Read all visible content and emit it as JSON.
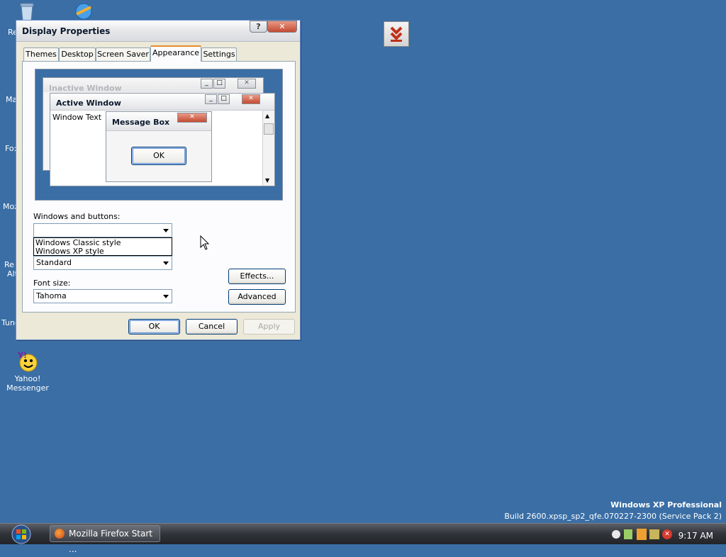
{
  "desktop": {
    "yahoo_label": "Yahoo!\nMessenger",
    "clipped_labels": [
      "Re",
      "Ma",
      "Fo:",
      "Moz",
      "Re",
      "Alt",
      "Tune"
    ]
  },
  "dialog": {
    "title": "Display Properties",
    "help_symbol": "?",
    "close_symbol": "✕",
    "tabs": [
      "Themes",
      "Desktop",
      "Screen Saver",
      "Appearance",
      "Settings"
    ],
    "active_tab": "Appearance",
    "preview": {
      "inactive_title": "Inactive Window",
      "active_title": "Active Window",
      "window_text": "Window Text",
      "msgbox_title": "Message Box",
      "msgbox_ok": "OK"
    },
    "windows_buttons_label": "Windows and buttons:",
    "windows_buttons_value": "",
    "dropdown_options": [
      "Windows Classic style",
      "Windows XP style"
    ],
    "color_scheme_value": "Standard",
    "font_size_label": "Font size:",
    "font_size_value": "Tahoma",
    "effects_label": "Effects...",
    "advanced_label": "Advanced",
    "ok_label": "OK",
    "cancel_label": "Cancel",
    "apply_label": "Apply"
  },
  "watermark": {
    "line1": "Windows XP Professional",
    "line2": "Build 2600.xpsp_sp2_qfe.070227-2300 (Service Pack 2)"
  },
  "taskbar": {
    "task_label": "Mozilla Firefox Start ...",
    "clock": "9:17 AM"
  },
  "colors": {
    "desktop_bg": "#3a6ea5",
    "dialog_bg": "#ece9d8",
    "tab_highlight": "#e68b2c"
  }
}
